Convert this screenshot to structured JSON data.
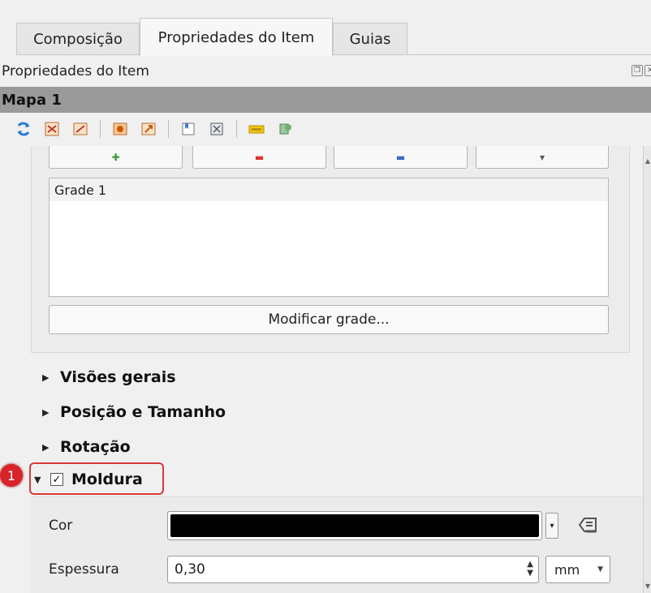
{
  "tabs": [
    {
      "label": "Composição"
    },
    {
      "label": "Propriedades do Item"
    },
    {
      "label": "Guias"
    }
  ],
  "panel_title": "Propriedades do Item",
  "item_header": "Mapa 1",
  "grid_list": {
    "items": [
      "Grade 1"
    ]
  },
  "modify_grid_button": "Modificar grade...",
  "sections": {
    "overviews": "Visões gerais",
    "position_size": "Posição e Tamanho",
    "rotation": "Rotação",
    "frame": "Moldura"
  },
  "annotation_badge": "1",
  "frame": {
    "color_label": "Cor",
    "color_value": "#000000",
    "thickness_label": "Espessura",
    "thickness_value": "0,30",
    "unit": "mm"
  },
  "icons": [
    "refresh-icon",
    "move-content-icon",
    "set-extent-icon",
    "zoom-extent-icon",
    "set-scale-icon",
    "bookmark-icon",
    "label-icon",
    "atlas-icon"
  ]
}
